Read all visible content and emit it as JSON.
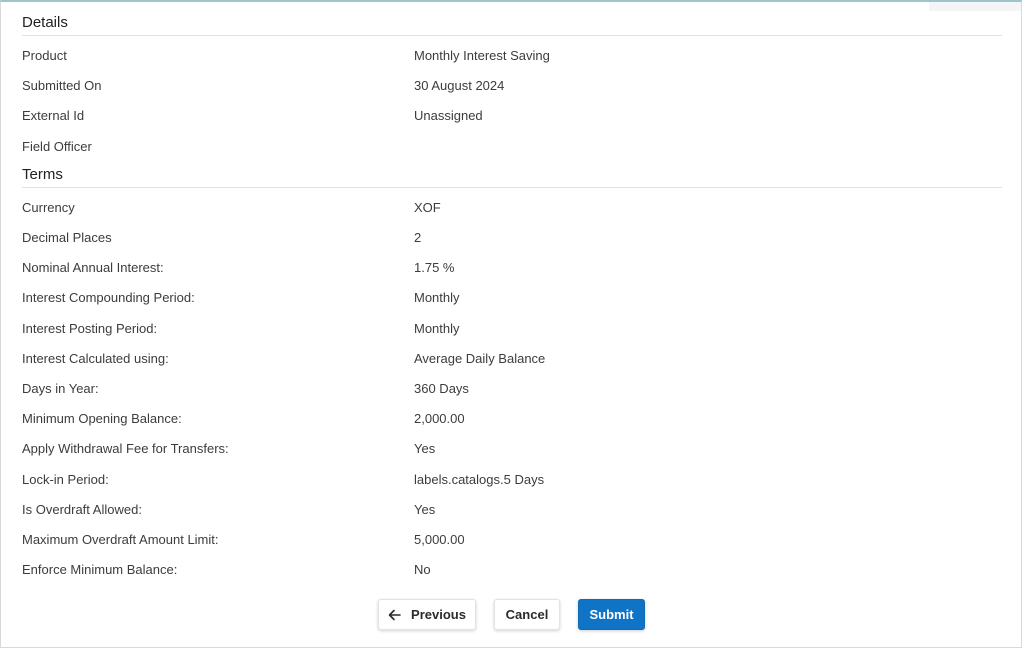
{
  "details": {
    "title": "Details",
    "rows": [
      {
        "label": "Product",
        "value": "Monthly Interest Saving"
      },
      {
        "label": "Submitted On",
        "value": "30 August 2024"
      },
      {
        "label": "External Id",
        "value": "Unassigned"
      },
      {
        "label": "Field Officer",
        "value": ""
      }
    ]
  },
  "terms": {
    "title": "Terms",
    "rows": [
      {
        "label": "Currency",
        "value": "XOF"
      },
      {
        "label": "Decimal Places",
        "value": "2"
      },
      {
        "label": "Nominal Annual Interest:",
        "value": "1.75 %"
      },
      {
        "label": "Interest Compounding Period:",
        "value": "Monthly"
      },
      {
        "label": "Interest Posting Period:",
        "value": "Monthly"
      },
      {
        "label": "Interest Calculated using:",
        "value": "Average Daily Balance"
      },
      {
        "label": "Days in Year:",
        "value": "360 Days"
      },
      {
        "label": "Minimum Opening Balance:",
        "value": "2,000.00"
      },
      {
        "label": "Apply Withdrawal Fee for Transfers:",
        "value": "Yes"
      },
      {
        "label": "Lock-in Period:",
        "value": "labels.catalogs.5 Days"
      },
      {
        "label": "Is Overdraft Allowed:",
        "value": "Yes"
      },
      {
        "label": "Maximum Overdraft Amount Limit:",
        "value": "5,000.00"
      },
      {
        "label": "Enforce Minimum Balance:",
        "value": "No"
      }
    ]
  },
  "actions": {
    "previous_label": "Previous",
    "cancel_label": "Cancel",
    "submit_label": "Submit",
    "previous_icon": "arrow-left-icon"
  },
  "colors": {
    "primary": "#1074c6",
    "divider": "#e0e0e0",
    "top_border": "#9ec5c9"
  }
}
